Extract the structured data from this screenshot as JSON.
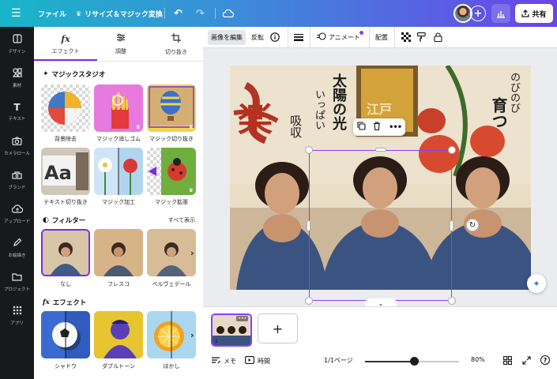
{
  "topbar": {
    "menu_icon": "menu-icon",
    "file": "ファイル",
    "resize": "リサイズ＆マジック変換",
    "share": "共有"
  },
  "rail": [
    {
      "icon": "design-icon",
      "label": "デザイン"
    },
    {
      "icon": "elements-icon",
      "label": "素材"
    },
    {
      "icon": "text-icon",
      "label": "テキスト"
    },
    {
      "icon": "camera-roll-icon",
      "label": "カメラロール"
    },
    {
      "icon": "brand-icon",
      "label": "ブランド"
    },
    {
      "icon": "upload-icon",
      "label": "アップロード"
    },
    {
      "icon": "draw-icon",
      "label": "お絵描き"
    },
    {
      "icon": "projects-icon",
      "label": "プロジェクト"
    },
    {
      "icon": "apps-icon",
      "label": "アプリ"
    }
  ],
  "panel": {
    "tabs": [
      {
        "label": "エフェクト",
        "icon": "fx-icon"
      },
      {
        "label": "調整",
        "icon": "sliders-icon"
      },
      {
        "label": "切り抜き",
        "icon": "crop-icon"
      }
    ],
    "magic_title": "マジックスタジオ",
    "magic": [
      {
        "label": "背景除去"
      },
      {
        "label": "マジック消しゴム"
      },
      {
        "label": "マジック切り抜き"
      },
      {
        "label": "テキスト切り抜き"
      },
      {
        "label": "マジック加工"
      },
      {
        "label": "マジック拡張"
      }
    ],
    "filter_title": "フィルター",
    "see_all": "すべて表示",
    "filters": [
      {
        "label": "なし"
      },
      {
        "label": "フレスコ"
      },
      {
        "label": "ベルヴェデール"
      }
    ],
    "effect_title": "エフェクト",
    "effects": [
      {
        "label": "シャドウ"
      },
      {
        "label": "ダブルトーン"
      },
      {
        "label": "ぼかし"
      }
    ]
  },
  "canvas_toolbar": {
    "edit_image": "画像を編集",
    "flip": "反転",
    "animate": "アニメート",
    "position": "配置"
  },
  "photo_text": {
    "left_big": "楽",
    "taiyo": "太陽の光",
    "ippai": "いっぱい",
    "kyushu": "吸収",
    "edo": "江戸",
    "nobinobi": "のびのび",
    "sodatsu": "育つ"
  },
  "bottom": {
    "page_num": "1",
    "notes": "メモ",
    "time": "時間",
    "pages": "1/1ページ",
    "zoom": "80%",
    "zoom_fraction": 0.52
  },
  "colors": {
    "accent": "#7d2ae8",
    "rail_bg": "#18191b",
    "selection": "#8b3dff"
  }
}
